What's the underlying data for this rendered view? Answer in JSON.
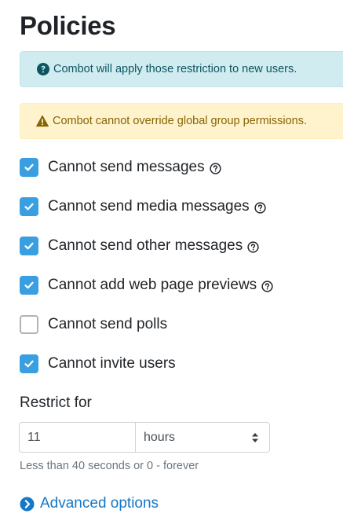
{
  "page": {
    "title": "Policies"
  },
  "alerts": {
    "info": {
      "icon": "question-circle-icon",
      "text": "Combot will apply those restriction to new users.",
      "color": "#0c5460"
    },
    "warning": {
      "icon": "warning-triangle-icon",
      "text": "Combot cannot override global group permissions.",
      "color": "#856404"
    }
  },
  "policies": [
    {
      "label": "Cannot send messages",
      "checked": true,
      "help": true
    },
    {
      "label": "Cannot send media messages",
      "checked": true,
      "help": true
    },
    {
      "label": "Cannot send other messages",
      "checked": true,
      "help": true
    },
    {
      "label": "Cannot add web page previews",
      "checked": true,
      "help": true
    },
    {
      "label": "Cannot send polls",
      "checked": false,
      "help": false
    },
    {
      "label": "Cannot invite users",
      "checked": true,
      "help": false
    }
  ],
  "restrict": {
    "label": "Restrict for",
    "value": "11",
    "unit": "hours",
    "hint": "Less than 40 seconds or 0 - forever"
  },
  "advanced": {
    "label": "Advanced options",
    "icon": "chevron-right-circle-icon"
  },
  "colors": {
    "accent": "#3a9fe0",
    "link": "#1478c8",
    "info_bg": "#d1ecf1",
    "warning_bg": "#fff3cd"
  }
}
